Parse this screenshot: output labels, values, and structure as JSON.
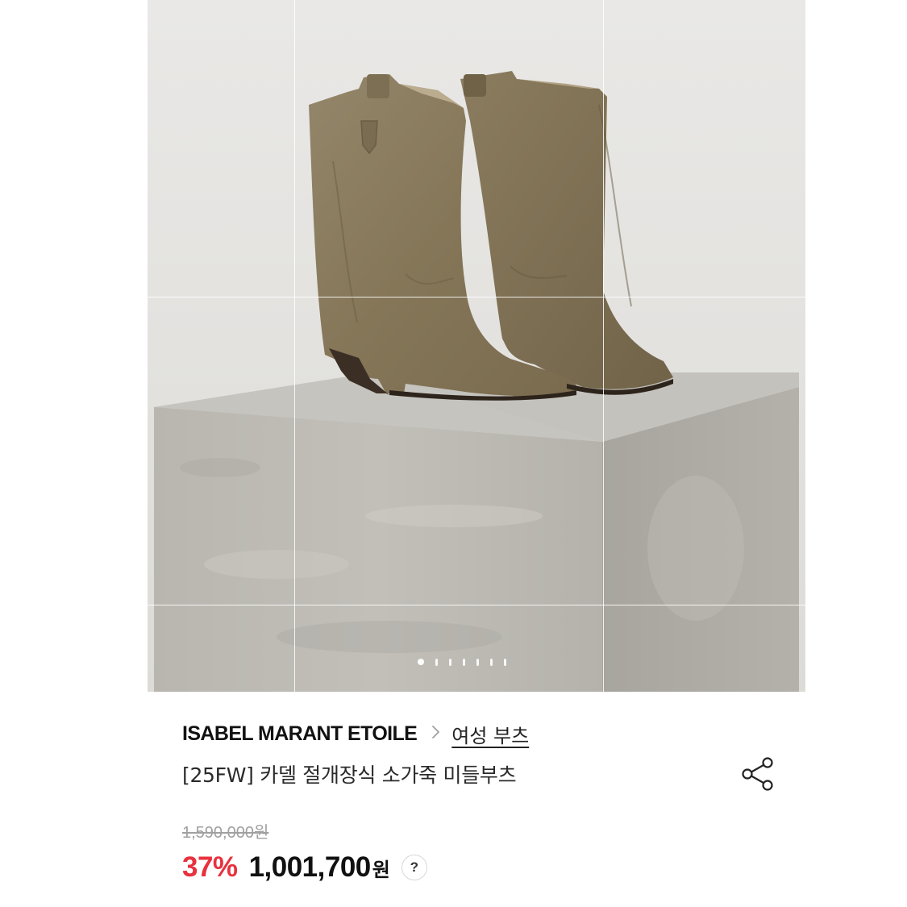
{
  "gallery": {
    "image_alt": "Suede western mid-calf boots on a concrete pedestal",
    "total_slides": 7,
    "active_slide": 1
  },
  "product": {
    "brand": "ISABEL MARANT ETOILE",
    "category": "여성 부츠",
    "name": "[25FW] 카델 절개장식 소가죽 미들부츠",
    "original_price": "1,590,000원",
    "discount": "37%",
    "price": "1,001,700",
    "currency": "원",
    "help_label": "?"
  },
  "icons": {
    "breadcrumb_separator": "chevron-right-icon",
    "share": "share-icon",
    "help": "question-icon"
  },
  "colors": {
    "discount": "#e8313e",
    "text": "#111111",
    "muted": "#a0a0a0"
  }
}
